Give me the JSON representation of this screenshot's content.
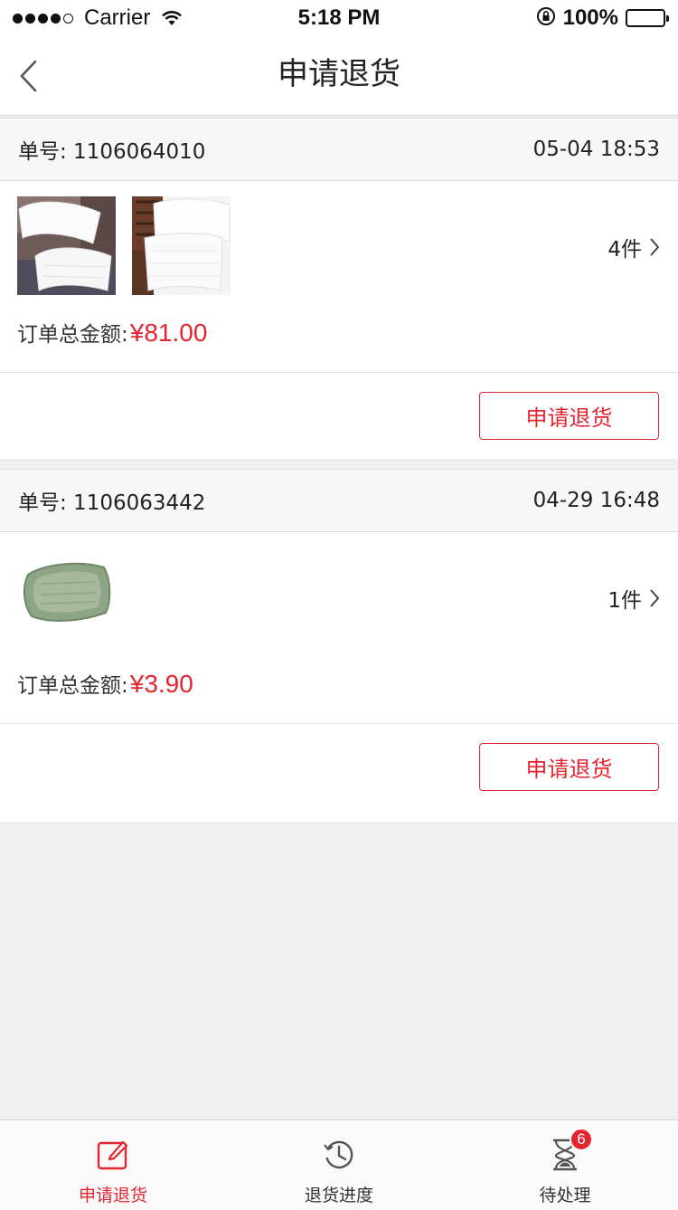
{
  "status_bar": {
    "carrier": "Carrier",
    "time": "5:18 PM",
    "battery": "100%"
  },
  "nav": {
    "title": "申请退货"
  },
  "orders": [
    {
      "number_label": "单号: 1106064010",
      "datetime": "05-04 18:53",
      "item_count": "4件",
      "total_label": "订单总金额:",
      "total_amount": "¥81.00",
      "button_label": "申请退货"
    },
    {
      "number_label": "单号: 1106063442",
      "datetime": "04-29 16:48",
      "item_count": "1件",
      "total_label": "订单总金额:",
      "total_amount": "¥3.90",
      "button_label": "申请退货"
    }
  ],
  "tabs": [
    {
      "label": "申请退货",
      "icon": "edit-icon",
      "active": true
    },
    {
      "label": "退货进度",
      "icon": "clock-history-icon",
      "active": false
    },
    {
      "label": "待处理",
      "icon": "hourglass-icon",
      "active": false,
      "badge": "6"
    }
  ],
  "colors": {
    "accent": "#e4252f",
    "background": "#f0eff0"
  }
}
